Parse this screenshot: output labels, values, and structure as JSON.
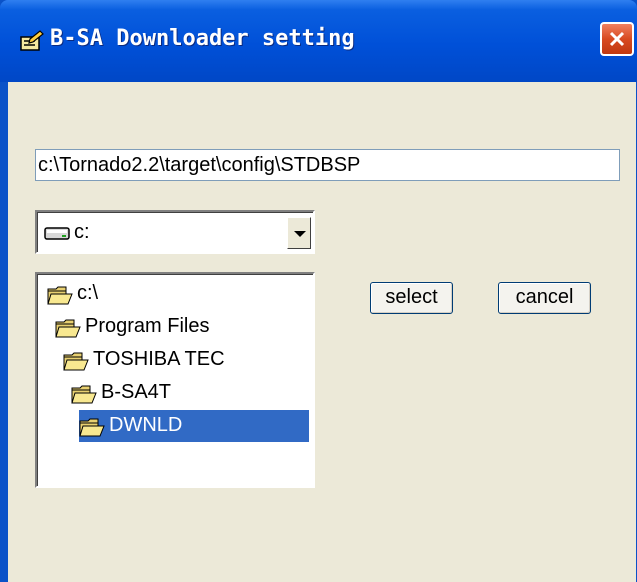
{
  "window": {
    "title": "B-SA Downloader setting",
    "title_icon": "pencil-notepad-icon",
    "close_icon": "close-x-icon"
  },
  "path_field": {
    "value": "c:\\Tornado2.2\\target\\config\\STDBSP"
  },
  "drive_select": {
    "value": "c:",
    "icon": "drive-icon",
    "arrow_icon": "dropdown-arrow-icon"
  },
  "folder_tree": {
    "items": [
      {
        "label": "c:\\",
        "depth": 0,
        "selected": false,
        "icon": "open-folder-icon"
      },
      {
        "label": "Program Files",
        "depth": 1,
        "selected": false,
        "icon": "open-folder-icon"
      },
      {
        "label": "TOSHIBA TEC",
        "depth": 2,
        "selected": false,
        "icon": "open-folder-icon"
      },
      {
        "label": "B-SA4T",
        "depth": 3,
        "selected": false,
        "icon": "open-folder-icon"
      },
      {
        "label": "DWNLD",
        "depth": 4,
        "selected": true,
        "icon": "open-folder-icon"
      }
    ]
  },
  "buttons": {
    "select_label": "select",
    "cancel_label": "cancel"
  },
  "colors": {
    "titlebar": "#0050d8",
    "client_bg": "#ece9d8",
    "selection": "#316ac5",
    "close_button": "#d84a20"
  }
}
